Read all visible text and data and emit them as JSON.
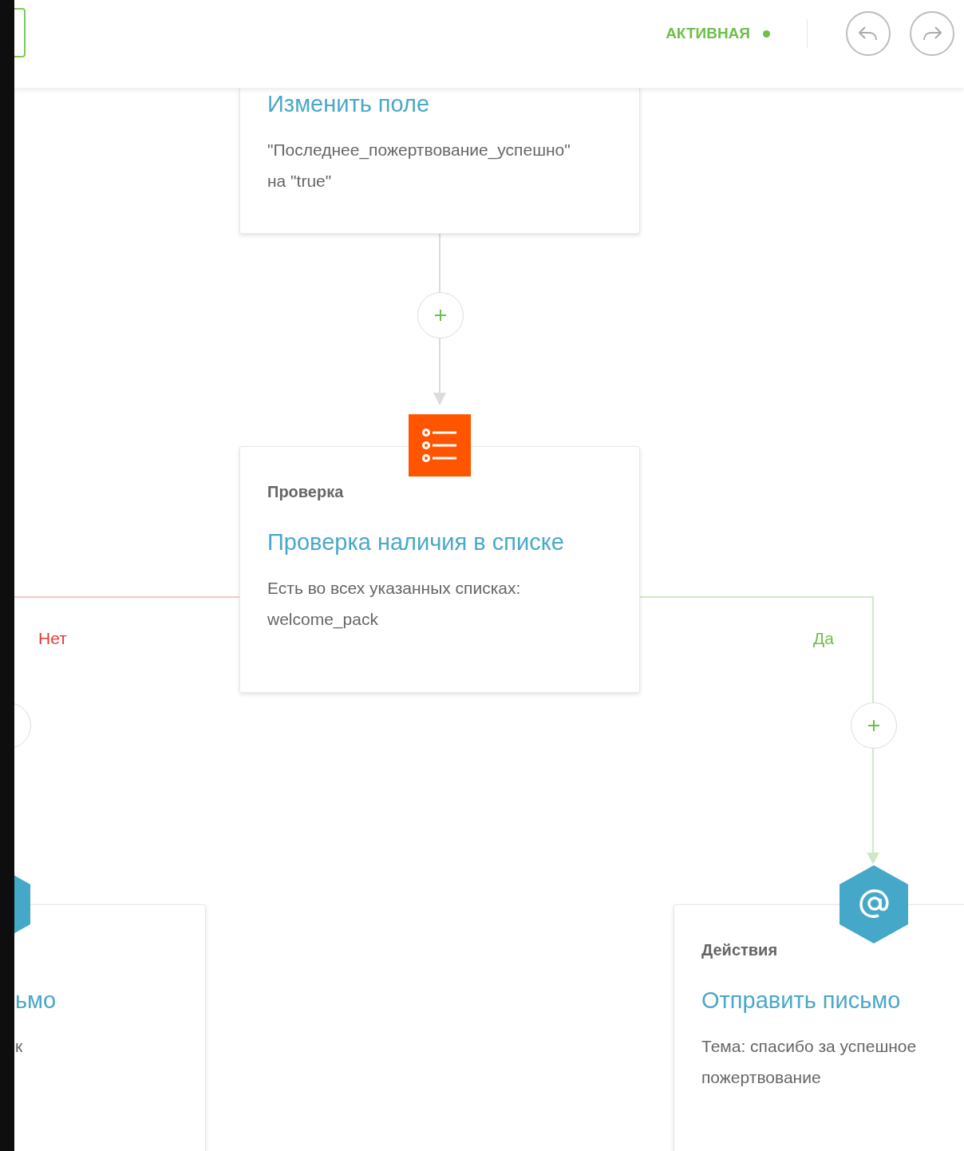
{
  "toolbar": {
    "status": {
      "label": "АКТИВНАЯ",
      "active": true
    }
  },
  "nodes": [
    {
      "kind": "field",
      "title": "Изменить поле",
      "description": "\"Последнее_пожертвование_успешно\" на \"true\""
    },
    {
      "kind": "check",
      "category": "Проверка",
      "title": "Проверка наличия в списке",
      "description": "Есть во всех указанных списках: welcome_pack"
    },
    {
      "kind": "action",
      "title": "ьмо",
      "description": "к"
    },
    {
      "kind": "action",
      "category": "Действия",
      "title": "Отправить письмо",
      "description": "Тема: спасибо за успешное пожертвование"
    }
  ],
  "branches": [
    {
      "kind": "no",
      "label": "Нет"
    },
    {
      "kind": "yes",
      "label": "Да"
    }
  ]
}
